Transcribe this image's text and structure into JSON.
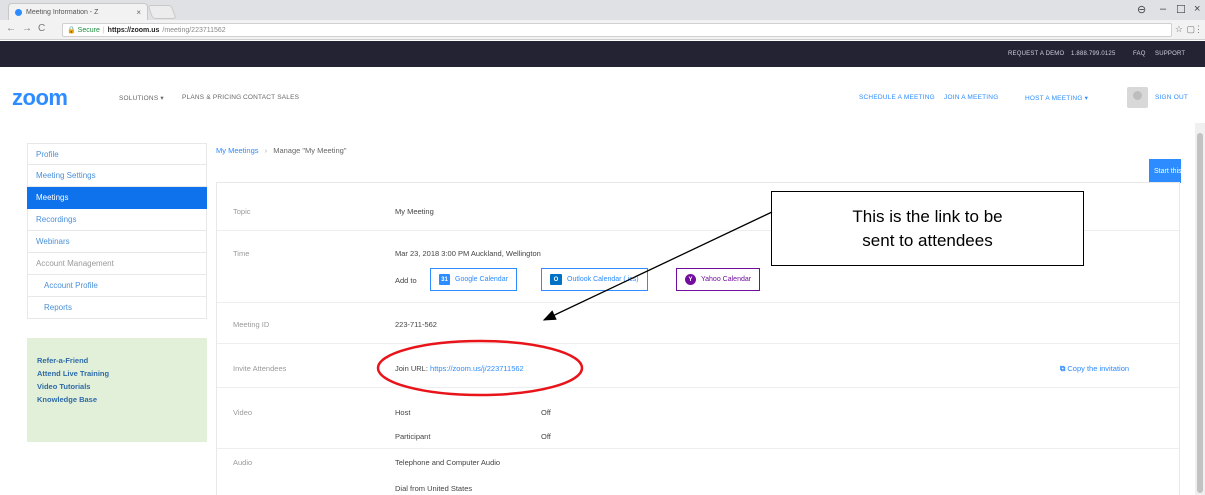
{
  "browser": {
    "tab_title": "Meeting Information - Z",
    "tab_close": "×",
    "url_secure": "🔒 Secure",
    "url_host": "https://zoom.us",
    "url_path": "/meeting/223711562",
    "window_controls": [
      "–",
      "☐",
      "×"
    ]
  },
  "topbar": {
    "links": [
      "REQUEST A DEMO",
      "1.888.799.0125",
      "FAQ",
      "SUPPORT"
    ]
  },
  "nav": {
    "logo": "zoom",
    "left": [
      "SOLUTIONS ▾",
      "PLANS & PRICING",
      "CONTACT SALES"
    ],
    "right": [
      "SCHEDULE A MEETING",
      "JOIN A MEETING",
      "HOST A MEETING ▾",
      "SIGN OUT"
    ]
  },
  "sidebar": {
    "items": [
      "Profile",
      "Meeting Settings",
      "Meetings",
      "Recordings",
      "Webinars",
      "Account Management",
      "Account Profile",
      "Reports"
    ],
    "active": "Meetings"
  },
  "help": {
    "links": [
      "Refer-a-Friend",
      "Attend Live Training",
      "Video Tutorials",
      "Knowledge Base"
    ]
  },
  "breadcrumb": {
    "parent": "My Meetings",
    "separator": "›",
    "current": "Manage \"My Meeting\""
  },
  "actions": {
    "start_meeting": "Start this Meeting",
    "copy_invitation": "Copy the invitation"
  },
  "meeting": {
    "topic_label": "Topic",
    "topic": "My Meeting",
    "time_label": "Time",
    "time": "Mar 23, 2018 3:00 PM Auckland, Wellington",
    "add_to_label": "Add to",
    "calendars": [
      "Google Calendar",
      "Outlook Calendar (.ics)",
      "Yahoo Calendar"
    ],
    "id_label": "Meeting ID",
    "id": "223-711-562",
    "invite_label": "Invite Attendees",
    "join_prefix": "Join URL:",
    "join_url": "https://zoom.us/j/223711562",
    "video_label": "Video",
    "host_label": "Host",
    "host_value": "Off",
    "participant_label": "Participant",
    "participant_value": "Off",
    "audio_label": "Audio",
    "audio_value": "Telephone and Computer Audio",
    "dial_from": "Dial from United States"
  },
  "annotation": {
    "line1": "This is the link to be",
    "line2": "sent to attendees"
  },
  "colors": {
    "brand": "#2d8cff",
    "topbar": "#232333",
    "sidebar_active": "#0e72ed",
    "help_bg": "#e2f0d9",
    "annotation_ellipse": "#e8141a"
  }
}
